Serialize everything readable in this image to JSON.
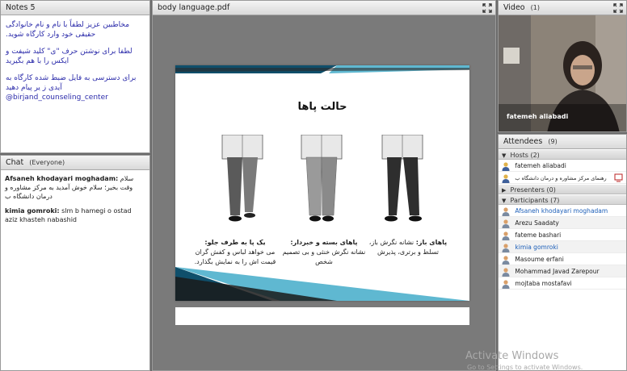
{
  "notes": {
    "title": "Notes 5",
    "lines": [
      "مخاطبین عزیز لطفاً با نام و نام خانوادگی حقیقی خود وارد کارگاه شوید.",
      "لطفا برای نوشتن حرف \"ی\" کلید شیفت و ایکس را با هم بگیرید",
      "برای دسترسی به فایل ضبط شده کارگاه به آیدی ز یر پیام دهید",
      "@birjand_counseling_center"
    ]
  },
  "chat": {
    "title": "Chat",
    "scope": "(Everyone)",
    "messages": [
      {
        "sender": "Afsaneh khodayari moghadam:",
        "text": "سلام وقت بخیر؛ سلام خوش آمدید به مرکز مشاوره و درمان دانشگاه ب"
      },
      {
        "sender": "kimia gomroki:",
        "text": "slm b hamegi  o ostad aziz khasteh nabashid"
      }
    ]
  },
  "doc": {
    "title": "body language.pdf",
    "slide_title": "حالت پاها",
    "captions": [
      {
        "head": "پاهای باز:",
        "body": "نشانه نگرش باز، تسلط و برتری، پذیرش"
      },
      {
        "head": "پاهای بسته و خبردار:",
        "body": "نشانه نگرش خنثی و بی تصمیم شخص"
      },
      {
        "head": "یک پا به طرف جلو:",
        "body": "می خواهد لباس و کفش گران قیمت اش را به نمایش بگذارد."
      }
    ]
  },
  "video": {
    "title": "Video",
    "count": "(1)",
    "name": "fatemeh aliabadi"
  },
  "attendees": {
    "title": "Attendees",
    "count": "(9)",
    "hosts_label": "Hosts (2)",
    "hosts": [
      "fatemeh aliabadi",
      "رهنمای مرکز مشاوره و درمان دانشگاه ب"
    ],
    "presenters_label": "Presenters (0)",
    "participants_label": "Participants (7)",
    "participants": [
      "Afsaneh khodayari moghadam",
      "Arezu Saadaty",
      "fateme bashari",
      "kimia gomroki",
      "Masoume erfani",
      "Mohammad Javad Zarepour",
      "mojtaba mostafavi"
    ]
  },
  "watermark": {
    "line1": "Activate Windows",
    "line2": "Go to Settings to activate Windows."
  },
  "colors": {
    "accent_blue": "#1d5fb8",
    "notes_text": "#2b2baa"
  }
}
